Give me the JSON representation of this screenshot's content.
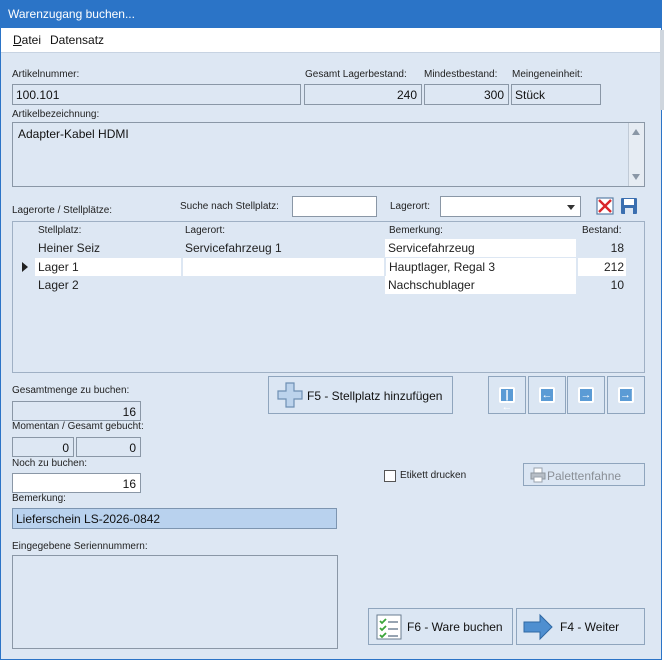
{
  "window": {
    "title": "Warenzugang buchen..."
  },
  "menu": {
    "file": "Datei",
    "file_accel": "D",
    "file_rest": "atei",
    "record": "Datensatz"
  },
  "labels": {
    "artikelnummer": "Artikelnummer:",
    "gesamt_lager": "Gesamt Lagerbestand:",
    "mindestbestand": "Mindestbestand:",
    "mengeneinheit": "Meingeneinheit:",
    "artikelbezeichnung": "Artikelbezeichnung:",
    "lagerorte": "Lagerorte / Stellplätze:",
    "suche": "Suche nach Stellplatz:",
    "lagerort": "Lagerort:",
    "gesamtmenge": "Gesamtmenge zu buchen:",
    "momentan": "Momentan / Gesamt gebucht:",
    "noch": "Noch zu buchen:",
    "bemerkung": "Bemerkung:",
    "serien": "Eingegebene Seriennummern:",
    "etikett": "Etikett drucken"
  },
  "article": {
    "number": "100.101",
    "total_stock": "240",
    "min_stock": "300",
    "unit": "Stück",
    "description": "Adapter-Kabel HDMI"
  },
  "search": {
    "stellplatz": "",
    "lagerort": ""
  },
  "table": {
    "headers": [
      "Stellplatz:",
      "Lagerort:",
      "Bemerkung:",
      "Bestand:"
    ],
    "rows": [
      {
        "stellplatz": "Heiner Seiz",
        "lagerort": "Servicefahrzeug 1",
        "bemerkung": "Servicefahrzeug",
        "bestand": "18"
      },
      {
        "stellplatz": "Lager 1",
        "lagerort": "",
        "bemerkung": "Hauptlager, Regal 3",
        "bestand": "212"
      },
      {
        "stellplatz": "Lager 2",
        "lagerort": "",
        "bemerkung": "Nachschublager",
        "bestand": "10"
      }
    ]
  },
  "booking": {
    "total": "16",
    "current": "0",
    "overall": "0",
    "remaining": "16",
    "remark": "Lieferschein LS-2026-0842",
    "serials": ""
  },
  "buttons": {
    "add_location": "F5 - Stellplatz hinzufügen",
    "palette": "Palettenfahne",
    "book": "F6 - Ware buchen",
    "next": "F4 - Weiter"
  },
  "colors": {
    "accent": "#2b74c7",
    "window_bg": "#dde7f3",
    "nav_icon": "#5b9bd5"
  }
}
